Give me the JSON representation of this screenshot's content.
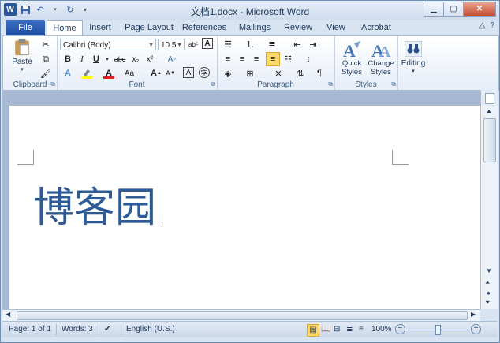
{
  "title": "文档1.docx - Microsoft Word",
  "tabs": {
    "file": "File",
    "home": "Home",
    "insert": "Insert",
    "page_layout": "Page Layout",
    "references": "References",
    "mailings": "Mailings",
    "review": "Review",
    "view": "View",
    "acrobat": "Acrobat"
  },
  "clipboard": {
    "label": "Clipboard",
    "paste": "Paste"
  },
  "font": {
    "label": "Font",
    "name": "Calibri (Body)",
    "size": "10.5"
  },
  "paragraph": {
    "label": "Paragraph"
  },
  "styles": {
    "label": "Styles",
    "quick": "Quick Styles",
    "change": "Change Styles"
  },
  "editing": {
    "label": "Editing"
  },
  "document": {
    "text": "博客园"
  },
  "status": {
    "page": "Page: 1 of 1",
    "words": "Words: 3",
    "language": "English (U.S.)",
    "zoom": "100%"
  },
  "colors": {
    "accent": "#2b579a",
    "text_blue": "#2e5a96"
  }
}
